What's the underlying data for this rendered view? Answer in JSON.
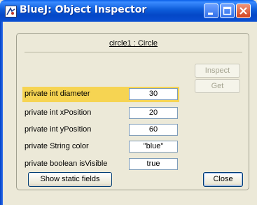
{
  "window": {
    "title": "BlueJ:  Object Inspector",
    "controls": [
      "minimize-icon",
      "maximize-icon",
      "close-icon"
    ]
  },
  "inspector": {
    "object_title": "circle1 : Circle",
    "fields": [
      {
        "label": "private int diameter",
        "value": "30",
        "selected": true
      },
      {
        "label": "private int xPosition",
        "value": "20",
        "selected": false
      },
      {
        "label": "private int yPosition",
        "value": "60",
        "selected": false
      },
      {
        "label": "private String color",
        "value": "\"blue\"",
        "selected": false
      },
      {
        "label": "private boolean isVisible",
        "value": "true",
        "selected": false
      }
    ],
    "buttons": {
      "inspect": "Inspect",
      "get": "Get",
      "show_static": "Show static fields",
      "close": "Close"
    }
  },
  "colors": {
    "titlebar": "#0a4fd2",
    "selected_row": "#f6d452",
    "panel_bg": "#ece9d8"
  }
}
